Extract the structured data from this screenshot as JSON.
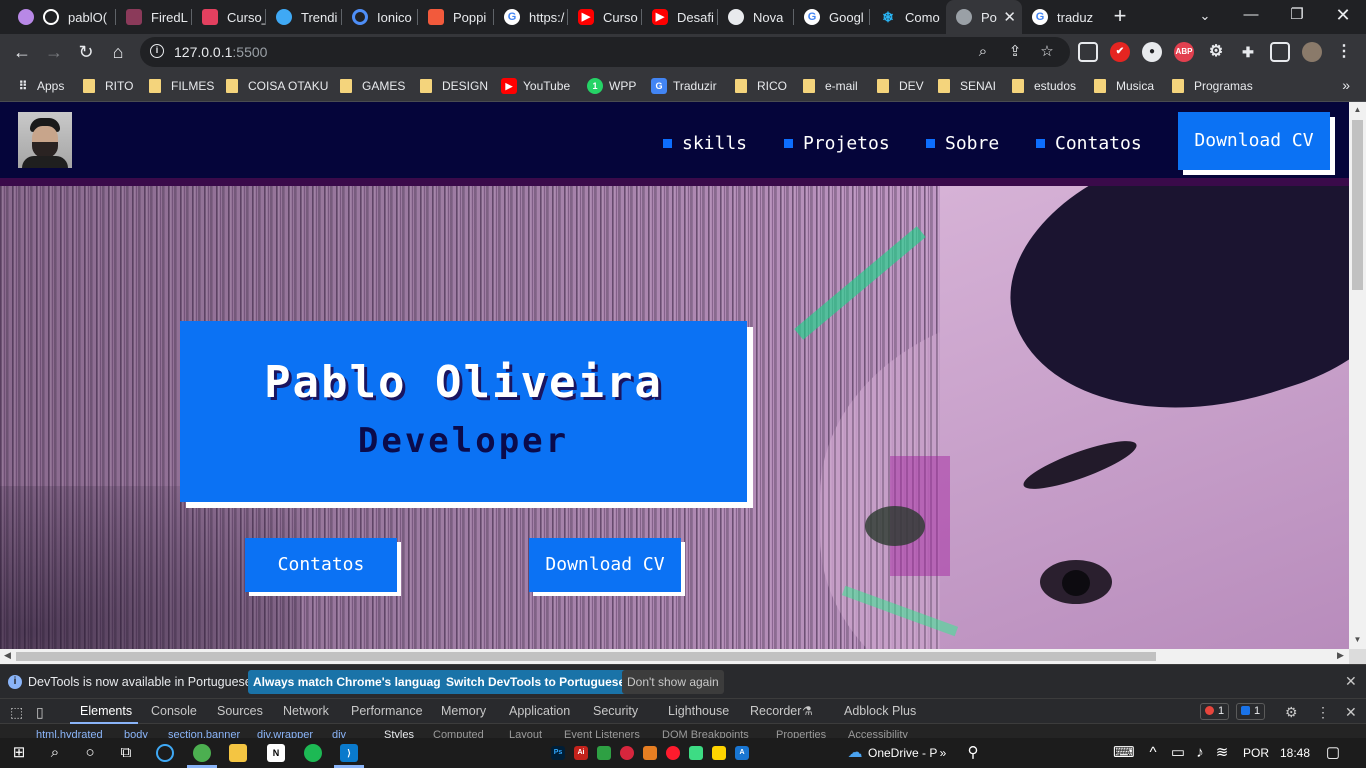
{
  "browser": {
    "tabs": [
      {
        "title": "pablO(",
        "icon": "github-icon",
        "color": "#b888e6"
      },
      {
        "title": "FiredL",
        "icon": "github-icon",
        "color": "#ffffff"
      },
      {
        "title": "Curso_",
        "icon": "figma-icon",
        "color": "#e3405f"
      },
      {
        "title": "Trendi",
        "icon": "blue-circle-icon",
        "color": "#3fa9f5"
      },
      {
        "title": "Ionico",
        "icon": "ionic-icon",
        "color": "#4e8ef7"
      },
      {
        "title": "Poppi",
        "icon": "fonts-icon",
        "color": "#f25a3c"
      },
      {
        "title": "https:/",
        "icon": "google-icon",
        "color": "#ffffff"
      },
      {
        "title": "Curso",
        "icon": "youtube-icon",
        "color": "#ff0000"
      },
      {
        "title": "Desafi",
        "icon": "youtube-icon",
        "color": "#ff0000"
      },
      {
        "title": "Nova",
        "icon": "chrome-icon",
        "color": "#e8eaed"
      },
      {
        "title": "Googl",
        "icon": "google-icon",
        "color": "#ffffff"
      },
      {
        "title": "Como",
        "icon": "snowflake-icon",
        "color": "#29b6f6"
      },
      {
        "title": "Po",
        "icon": "globe-icon",
        "color": "#9aa0a6",
        "active": true
      },
      {
        "title": "traduz",
        "icon": "google-icon",
        "color": "#ffffff"
      }
    ],
    "url_host": "127.0.0.1",
    "url_port": ":5500",
    "bookmarks": [
      {
        "label": "Apps",
        "type": "apps"
      },
      {
        "label": "RITO",
        "type": "folder"
      },
      {
        "label": "FILMES",
        "type": "folder"
      },
      {
        "label": "COISA OTAKU",
        "type": "folder"
      },
      {
        "label": "GAMES",
        "type": "folder"
      },
      {
        "label": "DESIGN",
        "type": "folder"
      },
      {
        "label": "YouTube",
        "type": "youtube"
      },
      {
        "label": "WPP",
        "type": "whatsapp"
      },
      {
        "label": "Traduzir",
        "type": "translate"
      },
      {
        "label": "RICO",
        "type": "folder"
      },
      {
        "label": "e-mail",
        "type": "folder"
      },
      {
        "label": "DEV",
        "type": "folder"
      },
      {
        "label": "SENAI",
        "type": "folder"
      },
      {
        "label": "estudos",
        "type": "folder"
      },
      {
        "label": "Musica",
        "type": "folder"
      },
      {
        "label": "Programas",
        "type": "folder"
      }
    ]
  },
  "site": {
    "nav": [
      "skills",
      "Projetos",
      "Sobre",
      "Contatos"
    ],
    "header_cv": "Download CV",
    "hero_name": "Pablo Oliveira",
    "hero_role": "Developer",
    "btn_contatos": "Contatos",
    "btn_cv": "Download CV",
    "accent": "#0b72f4",
    "header_bg": "#05053a"
  },
  "devtools": {
    "info_text": "DevTools is now available in Portuguese!",
    "btn_match": "Always match Chrome's language",
    "btn_switch": "Switch DevTools to Portuguese",
    "btn_dont": "Don't show again",
    "tabs": [
      "Elements",
      "Console",
      "Sources",
      "Network",
      "Performance",
      "Memory",
      "Application",
      "Security",
      "Lighthouse",
      "Recorder",
      "Adblock Plus"
    ],
    "errors": "1",
    "messages": "1",
    "crumbs": [
      "html.hydrated",
      "body",
      "section.banner",
      "div.wrapper",
      "div"
    ],
    "subtabs": [
      "Styles",
      "Computed",
      "Layout",
      "Event Listeners",
      "DOM Breakpoints",
      "Properties",
      "Accessibility"
    ]
  },
  "taskbar": {
    "onedrive": "OneDrive - P",
    "lang": "POR",
    "time": "18:48"
  }
}
